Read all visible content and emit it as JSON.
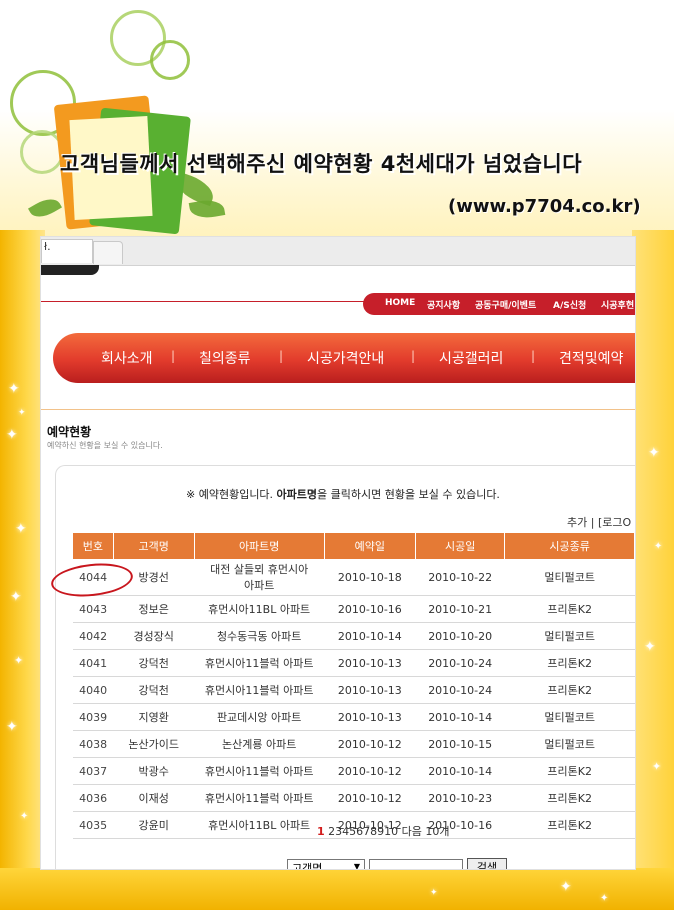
{
  "banner": {
    "headline": "고객님들께서 선택해주신 예약현황 4천세대가 넘었습니다",
    "url": "(www.p7704.co.kr)"
  },
  "browser": {
    "tab_label": "ł."
  },
  "toplinks": [
    "HOME",
    "공지사항",
    "공동구매/이벤트",
    "A/S신청",
    "시공후현"
  ],
  "nav": [
    "회사소개",
    "칠의종류",
    "시공가격안내",
    "시공갤러리",
    "견적및예약"
  ],
  "section": {
    "title": "예약현황",
    "subtitle": "예약하신 현황을 보실 수 있습니다."
  },
  "notice": {
    "pre": "※ 예약현황입니다. ",
    "bold": "아파트명",
    "post": "을 클릭하시면 현황을 보실 수 있습니다."
  },
  "small_links": "추가 | [로그O",
  "table": {
    "headers": [
      "번호",
      "고객명",
      "아파트명",
      "예약일",
      "시공일",
      "시공종류"
    ],
    "rows": [
      [
        "4044",
        "방경선",
        "대전 살들뫼 휴먼시아\n아파트",
        "2010-10-18",
        "2010-10-22",
        "멀티펄코트"
      ],
      [
        "4043",
        "정보은",
        "휴먼시아11BL 아파트",
        "2010-10-16",
        "2010-10-21",
        "프리톤K2"
      ],
      [
        "4042",
        "경성장식",
        "청수동극동 아파트",
        "2010-10-14",
        "2010-10-20",
        "멀티펄코트"
      ],
      [
        "4041",
        "강덕천",
        "휴먼시아11블럭 아파트",
        "2010-10-13",
        "2010-10-24",
        "프리톤K2"
      ],
      [
        "4040",
        "강덕천",
        "휴먼시아11블럭 아파트",
        "2010-10-13",
        "2010-10-24",
        "프리톤K2"
      ],
      [
        "4039",
        "지영환",
        "판교데시앙 아파트",
        "2010-10-13",
        "2010-10-14",
        "멀티펄코트"
      ],
      [
        "4038",
        "논산가이드",
        "논산계룡 아파트",
        "2010-10-12",
        "2010-10-15",
        "멀티펄코트"
      ],
      [
        "4037",
        "박광수",
        "휴먼시아11블럭 아파트",
        "2010-10-12",
        "2010-10-14",
        "프리톤K2"
      ],
      [
        "4036",
        "이재성",
        "휴먼시아11블럭 아파트",
        "2010-10-12",
        "2010-10-23",
        "프리톤K2"
      ],
      [
        "4035",
        "강윤미",
        "휴먼시아11BL 아파트",
        "2010-10-12",
        "2010-10-16",
        "프리톤K2"
      ]
    ]
  },
  "pager": {
    "current": "1",
    "pages": [
      "2",
      "3",
      "4",
      "5",
      "6",
      "7",
      "8",
      "9",
      "10"
    ],
    "next": "다음 10개"
  },
  "search": {
    "select_value": "고객명",
    "button": "검색"
  },
  "colors": {
    "header_orange": "#e57a35",
    "nav_red": "#e23b2c",
    "circle_red": "#c8161d",
    "gold": "#ffd530"
  }
}
